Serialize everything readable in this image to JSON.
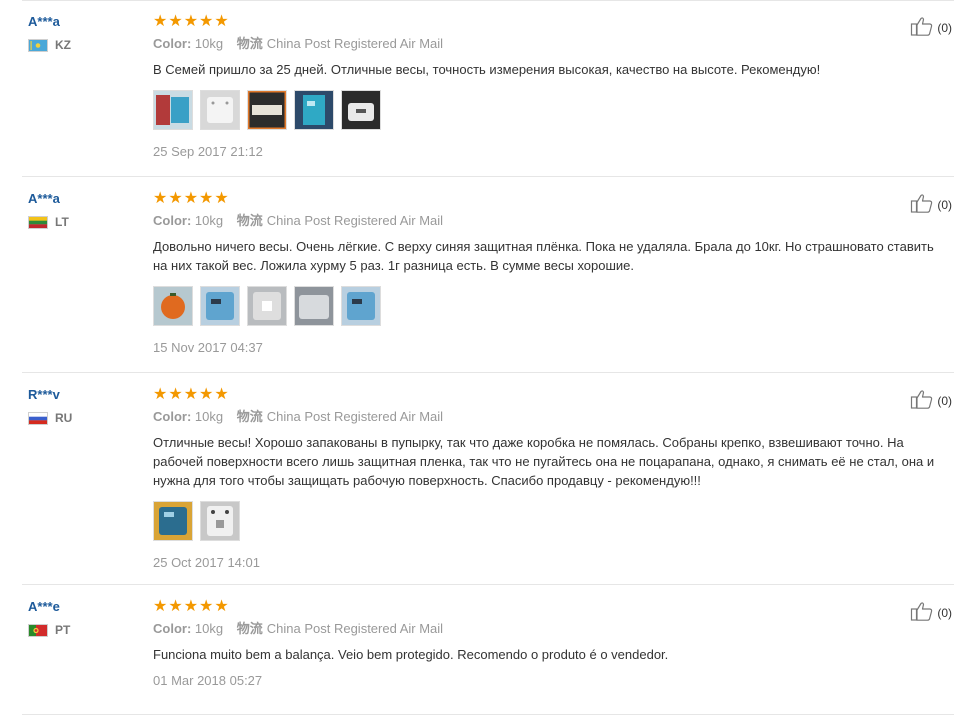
{
  "labels": {
    "color": "Color:",
    "shipping": "物流"
  },
  "reviews": [
    {
      "user": "A***a",
      "country": "KZ",
      "flag": "kz",
      "stars": 5,
      "color": "10kg",
      "shipping": "China Post Registered Air Mail",
      "text": "В Семей пришло за 25 дней. Отличные весы, точность измерения высокая, качество на высоте. Рекомендую!",
      "photos": [
        "box-red",
        "scale-white",
        "scale-dark-orange",
        "scale-blue",
        "scale-white-dark"
      ],
      "date": "25 Sep 2017 21:12",
      "helpful": "(0)"
    },
    {
      "user": "A***a",
      "country": "LT",
      "flag": "lt",
      "stars": 5,
      "color": "10kg",
      "shipping": "China Post Registered Air Mail",
      "text": "Довольно ничего весы. Очень лёгкие. С верху синяя защитная плёнка. Пока не удаляла. Брала до 10кг. Но страшновато ставить на них такой вес. Ложила хурму 5 раз. 1г разница есть. В сумме весы хорошие.",
      "photos": [
        "persimmon",
        "scale-blue-light",
        "scale-back-grey",
        "scale-grey",
        "scale-blue-light"
      ],
      "date": "15 Nov 2017 04:37",
      "helpful": "(0)"
    },
    {
      "user": "R***v",
      "country": "RU",
      "flag": "ru",
      "stars": 5,
      "color": "10kg",
      "shipping": "China Post Registered Air Mail",
      "text": "Отличные весы! Хорошо запакованы в пупырку, так что даже коробка не помялась. Собраны крепко, взвешивают точно. На рабочей поверхности всего лишь защитная пленка, так что не пугайтесь она не поцарапана, однако, я снимать её не стал, она и нужна для того чтобы защищать рабочую поверхность. Спасибо продавцу - рекомендую!!!",
      "photos": [
        "scale-blue-gold",
        "scale-back-white"
      ],
      "date": "25 Oct 2017 14:01",
      "helpful": "(0)"
    },
    {
      "user": "A***e",
      "country": "PT",
      "flag": "pt",
      "stars": 5,
      "color": "10kg",
      "shipping": "China Post Registered Air Mail",
      "text": "Funciona muito bem a balança. Veio bem protegido. Recomendo o produto é o vendedor.",
      "photos": [],
      "date": "01 Mar 2018 05:27",
      "helpful": "(0)"
    }
  ]
}
